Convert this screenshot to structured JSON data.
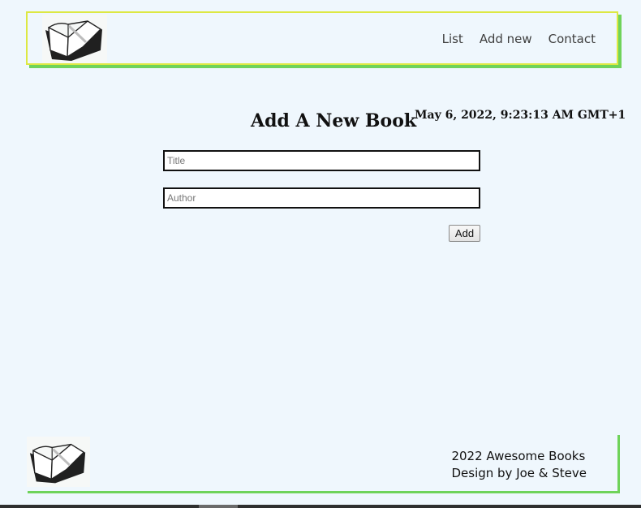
{
  "header": {
    "logo_icon": "open-book-icon",
    "nav": [
      {
        "label": "List"
      },
      {
        "label": "Add new"
      },
      {
        "label": "Contact"
      }
    ]
  },
  "main": {
    "datetime": "May 6, 2022, 9:23:13 AM GMT+1",
    "title": "Add A New Book",
    "form": {
      "title_placeholder": "Title",
      "title_value": "",
      "author_placeholder": "Author",
      "author_value": "",
      "add_label": "Add"
    }
  },
  "footer": {
    "logo_icon": "open-book-icon",
    "line1": "2022 Awesome Books",
    "line2": "Design by Joe & Steve"
  },
  "colors": {
    "background": "#eff7fd",
    "header_border": "#dde843",
    "accent_green": "#6fd35a"
  }
}
